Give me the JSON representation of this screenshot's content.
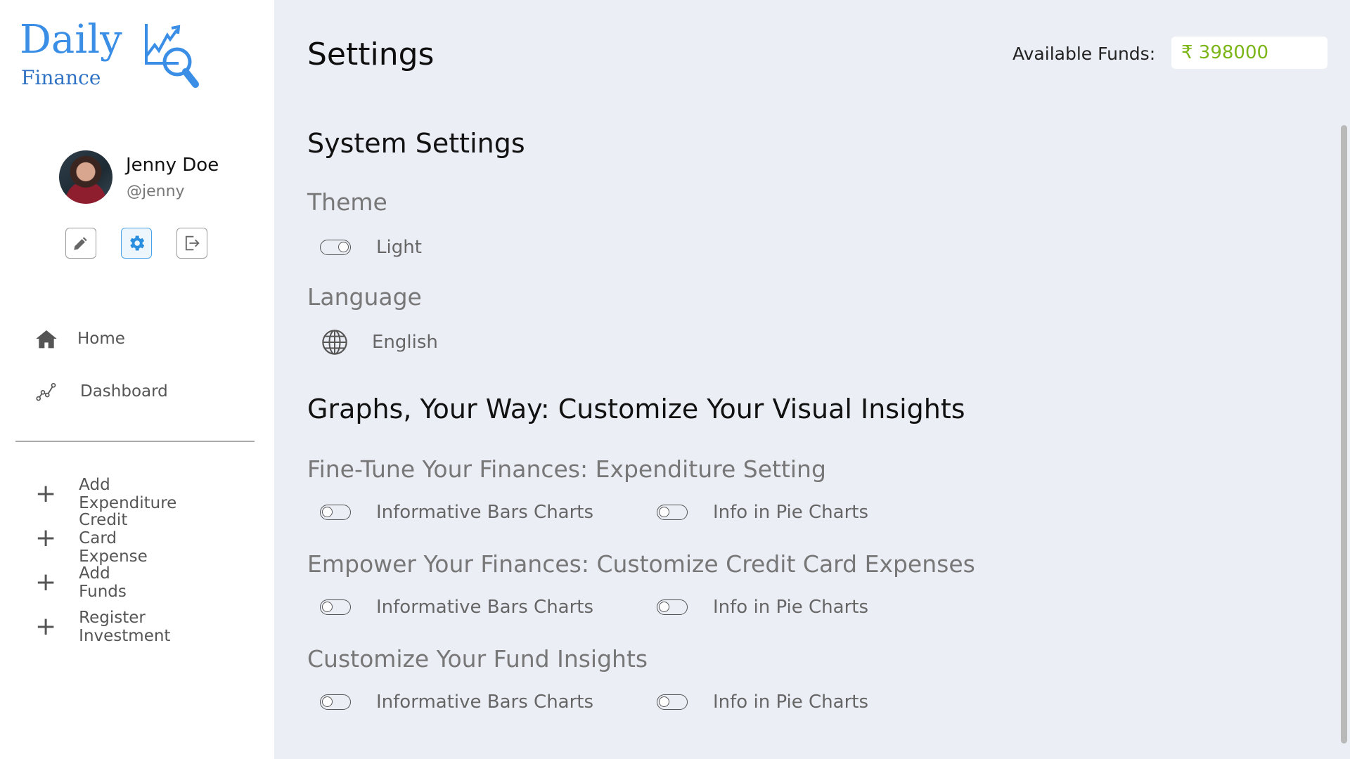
{
  "brand": {
    "name": "Daily",
    "subtitle": "Finance"
  },
  "user": {
    "name": "Jenny Doe",
    "handle": "@jenny"
  },
  "profile_actions": {
    "edit_icon": "pencil-icon",
    "settings_icon": "gear-icon",
    "logout_icon": "logout-icon",
    "active": "settings"
  },
  "nav": [
    {
      "label": "Home",
      "icon": "home-icon"
    },
    {
      "label": "Dashboard",
      "icon": "chart-line-icon"
    }
  ],
  "quick_actions": [
    {
      "label": "Add Expenditure",
      "icon": "plus-icon"
    },
    {
      "label": "Credit Card Expense",
      "icon": "plus-icon"
    },
    {
      "label": "Add Funds",
      "icon": "plus-icon"
    },
    {
      "label": "Register Investment",
      "icon": "plus-icon"
    }
  ],
  "header": {
    "title": "Settings",
    "funds_label": "Available Funds:",
    "funds_value": "₹ 398000"
  },
  "system_settings": {
    "title": "System Settings",
    "theme": {
      "label": "Theme",
      "value": "Light",
      "toggle_on": true
    },
    "language": {
      "label": "Language",
      "value": "English",
      "icon": "globe-icon"
    }
  },
  "graphs": {
    "title": "Graphs, Your Way: Customize Your Visual Insights",
    "sections": [
      {
        "title": "Fine-Tune Your Finances: Expenditure Setting",
        "options": [
          {
            "label": "Informative Bars Charts",
            "on": false
          },
          {
            "label": "Info in Pie Charts",
            "on": false
          }
        ]
      },
      {
        "title": "Empower Your Finances: Customize Credit Card Expenses",
        "options": [
          {
            "label": "Informative Bars Charts",
            "on": false
          },
          {
            "label": "Info in Pie Charts",
            "on": false
          }
        ]
      },
      {
        "title": "Customize Your Fund Insights",
        "options": [
          {
            "label": "Informative Bars Charts",
            "on": false
          },
          {
            "label": "Info in Pie Charts",
            "on": false
          }
        ]
      }
    ]
  },
  "colors": {
    "accent": "#3a8ee6",
    "funds_green": "#7cb518",
    "background": "#eceef6"
  }
}
